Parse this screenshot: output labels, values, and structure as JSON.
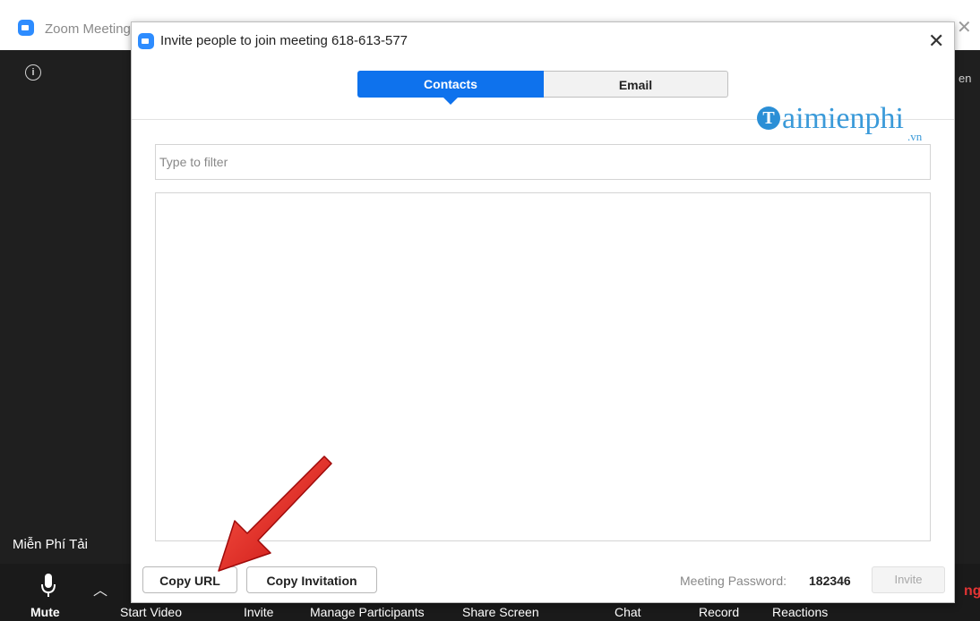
{
  "main_window": {
    "title": "Zoom Meeting",
    "info_icon": "info-icon",
    "right_edge_text": "en",
    "left_label": "Miễn Phí Tải",
    "brand_fragment": "ng",
    "toolbar": {
      "mute": "Mute",
      "start_video": "Start Video",
      "invite": "Invite",
      "manage_participants": "Manage Participants",
      "share_screen": "Share Screen",
      "chat": "Chat",
      "record": "Record",
      "reactions": "Reactions"
    }
  },
  "dialog": {
    "title": "Invite people to join meeting 618-613-577",
    "tabs": [
      {
        "label": "Contacts",
        "active": true
      },
      {
        "label": "Email",
        "active": false
      }
    ],
    "filter": {
      "placeholder": "Type to filter",
      "value": ""
    },
    "buttons": {
      "copy_url": "Copy URL",
      "copy_invitation": "Copy Invitation",
      "invite": "Invite"
    },
    "password_label": "Meeting Password:",
    "password_value": "182346"
  },
  "watermark": {
    "letter": "T",
    "text": "aimienphi",
    "suffix": ".vn"
  },
  "colors": {
    "accent": "#0e72ed",
    "zoom_blue": "#2d8cff",
    "arrow_red": "#e01e1e",
    "dark_bg": "#1f1f1f"
  }
}
